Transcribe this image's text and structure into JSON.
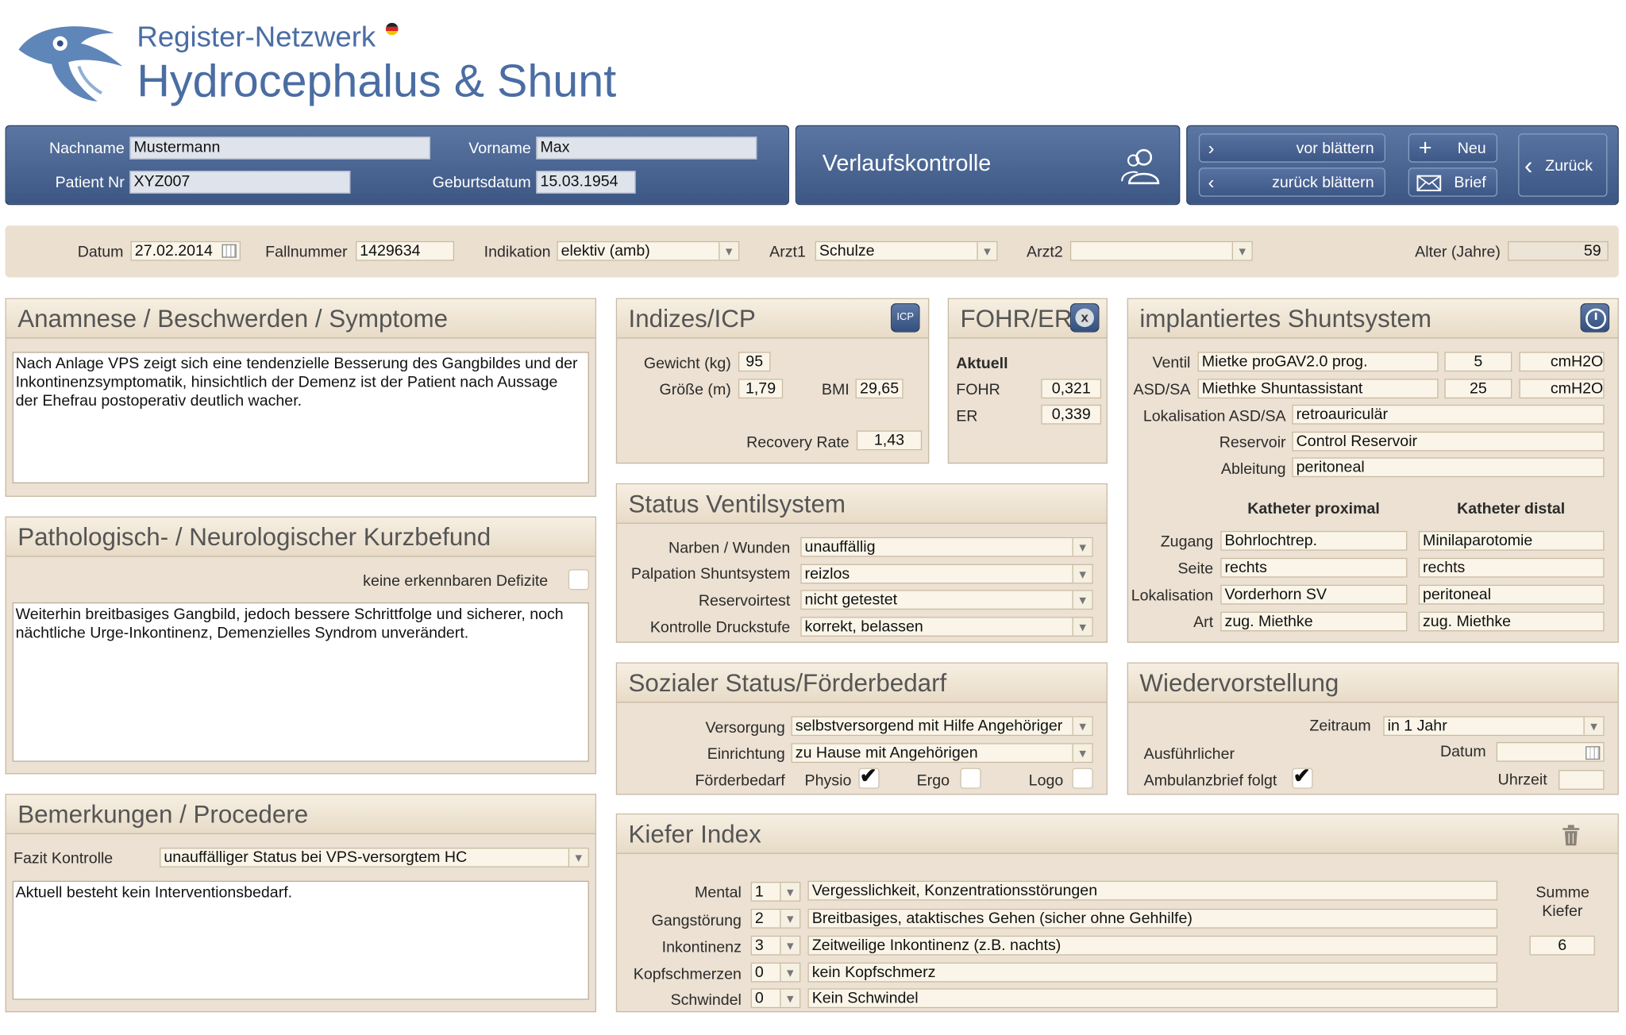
{
  "app": {
    "logo_line1": "Register-Netzwerk",
    "logo_line2": "Hydrocephalus & Shunt"
  },
  "patient": {
    "nachname_label": "Nachname",
    "nachname": "Mustermann",
    "vorname_label": "Vorname",
    "vorname": "Max",
    "patientnr_label": "Patient Nr",
    "patientnr": "XYZ007",
    "geburtsdatum_label": "Geburtsdatum",
    "geburtsdatum": "15.03.1954"
  },
  "module": {
    "title": "Verlaufskontrolle",
    "icon": "users-icon"
  },
  "nav": {
    "vor": "vor blättern",
    "zurueck_blaettern": "zurück blättern",
    "neu": "Neu",
    "brief": "Brief",
    "zurueck": "Zurück"
  },
  "case": {
    "datum_label": "Datum",
    "datum": "27.02.2014",
    "fallnummer_label": "Fallnummer",
    "fallnummer": "1429634",
    "indikation_label": "Indikation",
    "indikation": "elektiv (amb)",
    "arzt1_label": "Arzt1",
    "arzt1": "Schulze",
    "arzt2_label": "Arzt2",
    "arzt2": "",
    "alter_label": "Alter (Jahre)",
    "alter": "59"
  },
  "anamnese": {
    "title": "Anamnese / Beschwerden / Symptome",
    "text": "Nach Anlage VPS zeigt sich eine tendenzielle Besserung des Gangbildes und der\nInkontinenzsymptomatik, hinsichtlich der Demenz ist der Patient nach Aussage\nder Ehefrau postoperativ deutlich wacher."
  },
  "befund": {
    "title": "Pathologisch- / Neurologischer Kurzbefund",
    "keine_defizite_label": "keine erkennbaren Defizite",
    "text": "Weiterhin breitbasiges Gangbild, jedoch bessere Schrittfolge und sicherer, noch\nnächtliche Urge-Inkontinenz, Demenzielles Syndrom unverändert."
  },
  "bemerkungen": {
    "title": "Bemerkungen / Procedere",
    "fazit_label": "Fazit  Kontrolle",
    "fazit": "unauffälliger Status bei VPS-versorgtem HC",
    "text": "Aktuell besteht kein Interventionsbedarf."
  },
  "indizes": {
    "title": "Indizes/ICP",
    "icp_button": "ICP",
    "gewicht_label": "Gewicht (kg)",
    "gewicht": "95",
    "groesse_label": "Größe (m)",
    "groesse": "1,79",
    "bmi_label": "BMI",
    "bmi": "29,65",
    "recovery_label": "Recovery Rate",
    "recovery": "1,43"
  },
  "fohr": {
    "title": "FOHR/ER",
    "aktuell_label": "Aktuell",
    "fohr_label": "FOHR",
    "fohr": "0,321",
    "er_label": "ER",
    "er": "0,339"
  },
  "shunt": {
    "title": "implantiertes Shuntsystem",
    "ventil_label": "Ventil",
    "ventil": "Mietke proGAV2.0 prog.",
    "ventil_val": "5",
    "ventil_unit": "cmH2O",
    "asd_label": "ASD/SA",
    "asd": "Miethke Shuntassistant",
    "asd_val": "25",
    "asd_unit": "cmH2O",
    "lok_asd_label": "Lokalisation ASD/SA",
    "lok_asd": "retroauriculär",
    "reservoir_label": "Reservoir",
    "reservoir": "Control Reservoir",
    "ableitung_label": "Ableitung",
    "ableitung": "peritoneal",
    "prox_header": "Katheter proximal",
    "dist_header": "Katheter distal",
    "zugang_label": "Zugang",
    "zugang_prox": "Bohrlochtrep.",
    "zugang_dist": "Minilaparotomie",
    "seite_label": "Seite",
    "seite_prox": "rechts",
    "seite_dist": "rechts",
    "lokal_label": "Lokalisation",
    "lokal_prox": "Vorderhorn SV",
    "lokal_dist": "peritoneal",
    "art_label": "Art",
    "art_prox": "zug. Miethke",
    "art_dist": "zug. Miethke"
  },
  "ventilstatus": {
    "title": "Status Ventilsystem",
    "narben_label": "Narben / Wunden",
    "narben": "unauffällig",
    "palpation_label": "Palpation Shuntsystem",
    "palpation": "reizlos",
    "reservoirtest_label": "Reservoirtest",
    "reservoirtest": "nicht getestet",
    "druckstufe_label": "Kontrolle Druckstufe",
    "druckstufe": "korrekt, belassen"
  },
  "sozial": {
    "title": "Sozialer Status/Förderbedarf",
    "versorgung_label": "Versorgung",
    "versorgung": "selbstversorgend mit Hilfe Angehöriger",
    "einrichtung_label": "Einrichtung",
    "einrichtung": "zu Hause mit Angehörigen",
    "foerder_label": "Förderbedarf",
    "physio": "Physio",
    "ergo": "Ergo",
    "logo": "Logo",
    "physio_checked": true,
    "ergo_checked": false,
    "logo_checked": false
  },
  "wieder": {
    "title": "Wiedervorstellung",
    "zeitraum_label": "Zeitraum",
    "zeitraum": "in 1 Jahr",
    "ausf_label": "Ausführlicher",
    "datum_label": "Datum",
    "datum": "",
    "brief_label": "Ambulanzbrief folgt",
    "uhrzeit_label": "Uhrzeit",
    "uhrzeit": "",
    "brief_checked": true
  },
  "kiefer": {
    "title": "Kiefer Index",
    "summe_label1": "Summe",
    "summe_label2": "Kiefer",
    "summe": "6",
    "rows": [
      {
        "label": "Mental",
        "score": "1",
        "text": "Vergesslichkeit, Konzentrationsstörungen"
      },
      {
        "label": "Gangstörung",
        "score": "2",
        "text": "Breitbasiges, ataktisches Gehen (sicher ohne Gehhilfe)"
      },
      {
        "label": "Inkontinenz",
        "score": "3",
        "text": "Zeitweilige Inkontinenz (z.B. nachts)"
      },
      {
        "label": "Kopfschmerzen",
        "score": "0",
        "text": "kein Kopfschmerz"
      },
      {
        "label": "Schwindel",
        "score": "0",
        "text": "Kein Schwindel"
      }
    ]
  },
  "colors": {
    "navy": "#3c5784",
    "panel": "#ece1d2",
    "field": "#faf5e8",
    "logo_blue": "#4a6da3"
  }
}
